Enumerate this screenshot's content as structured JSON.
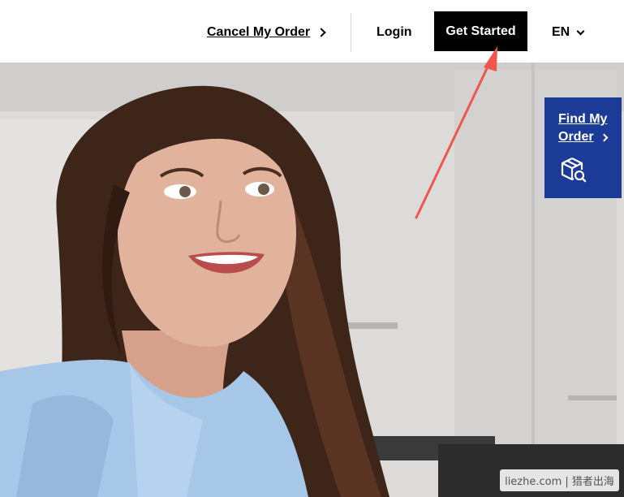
{
  "header": {
    "cancel_order": "Cancel My Order",
    "login": "Login",
    "get_started": "Get Started",
    "language": "EN"
  },
  "find_order": {
    "line1": "Find My",
    "line2": "Order"
  },
  "watermark": {
    "text": "liezhe.com | 猎者出海"
  },
  "colors": {
    "find_order_bg": "#1c3b97",
    "get_started_bg": "#000000",
    "arrow": "#f0554f"
  },
  "icons": [
    "chevron-right-icon",
    "chevron-down-icon",
    "package-search-icon",
    "annotation-arrow"
  ]
}
